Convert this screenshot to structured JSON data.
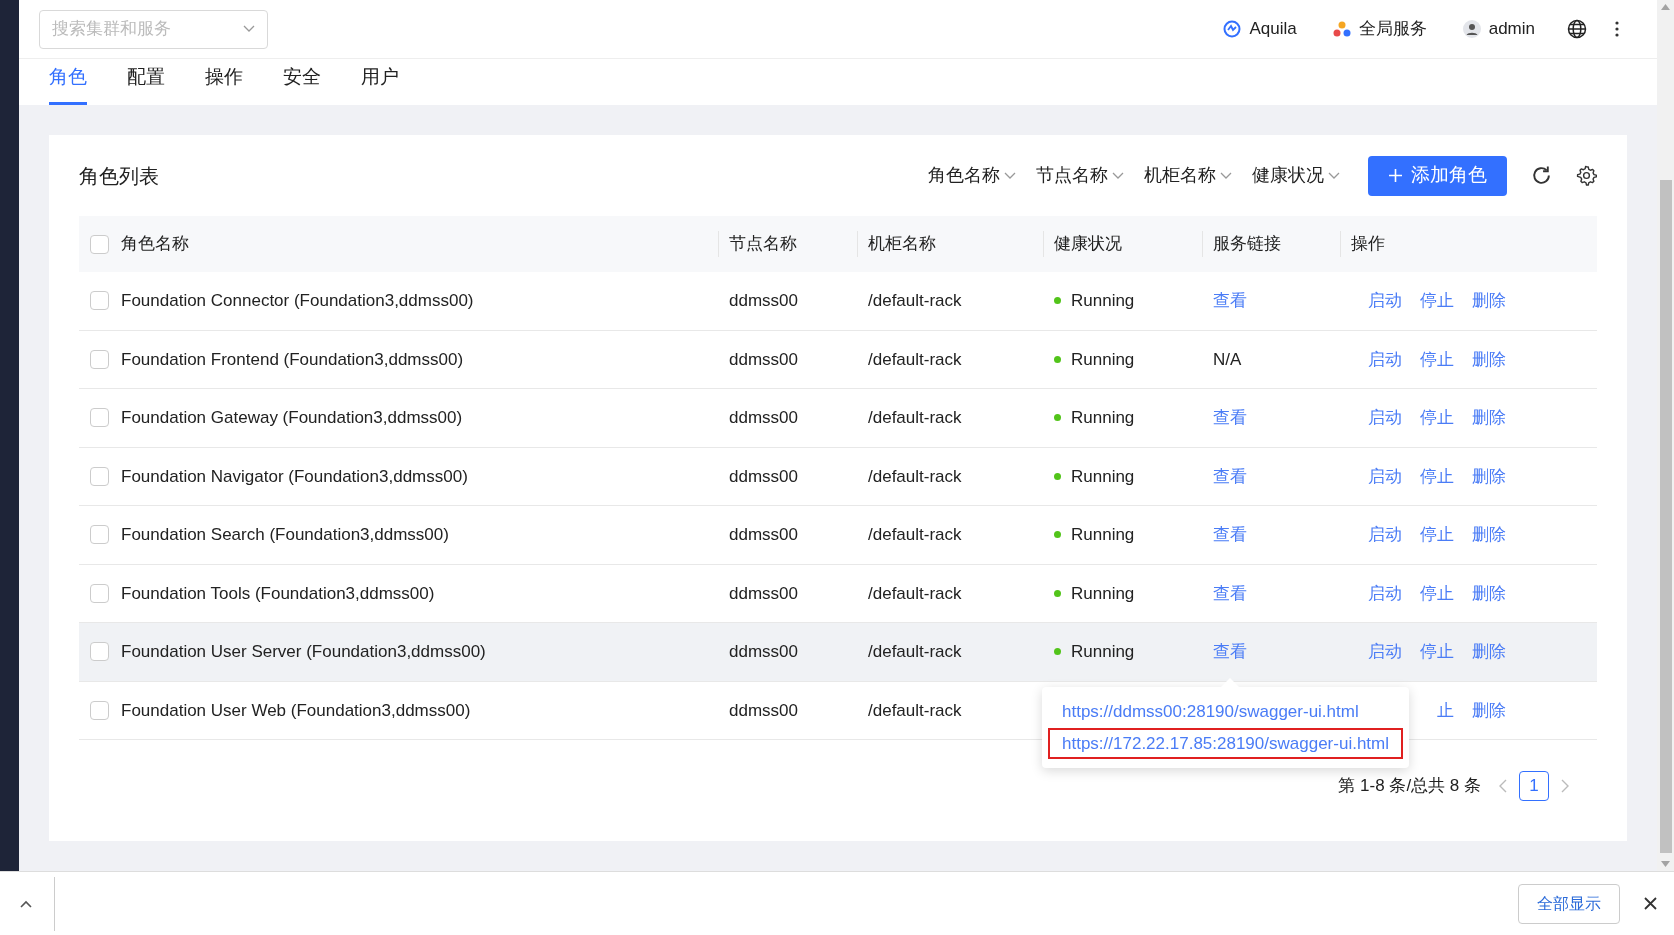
{
  "header": {
    "search": {
      "placeholder": "搜索集群和服务"
    },
    "cluster": "Aquila",
    "services": "全局服务",
    "user": "admin"
  },
  "tabs": [
    {
      "label": "角色",
      "selected": true
    },
    {
      "label": "配置",
      "selected": false
    },
    {
      "label": "操作",
      "selected": false
    },
    {
      "label": "安全",
      "selected": false
    },
    {
      "label": "用户",
      "selected": false
    }
  ],
  "card": {
    "title": "角色列表",
    "filters": [
      "角色名称",
      "节点名称",
      "机柜名称",
      "健康状况"
    ],
    "add_button": "添加角色"
  },
  "table": {
    "select_all": {
      "checked": false
    },
    "columns": [
      "角色名称",
      "节点名称",
      "机柜名称",
      "健康状况",
      "服务链接",
      "操作"
    ],
    "rows": [
      {
        "checked": false,
        "hovered": false,
        "name": "Foundation Connector (Foundation3,ddmss00)",
        "node": "ddmss00",
        "rack": "/default-rack",
        "health": "Running",
        "color": "#52c41a",
        "link": "查看",
        "linked": true,
        "actions": [
          "启动",
          "停止",
          "删除"
        ]
      },
      {
        "checked": false,
        "hovered": false,
        "name": "Foundation Frontend (Foundation3,ddmss00)",
        "node": "ddmss00",
        "rack": "/default-rack",
        "health": "Running",
        "color": "#52c41a",
        "link": "N/A",
        "linked": false,
        "actions": [
          "启动",
          "停止",
          "删除"
        ]
      },
      {
        "checked": false,
        "hovered": false,
        "name": "Foundation Gateway (Foundation3,ddmss00)",
        "node": "ddmss00",
        "rack": "/default-rack",
        "health": "Running",
        "color": "#52c41a",
        "link": "查看",
        "linked": true,
        "actions": [
          "启动",
          "停止",
          "删除"
        ]
      },
      {
        "checked": false,
        "hovered": false,
        "name": "Foundation Navigator (Foundation3,ddmss00)",
        "node": "ddmss00",
        "rack": "/default-rack",
        "health": "Running",
        "color": "#52c41a",
        "link": "查看",
        "linked": true,
        "actions": [
          "启动",
          "停止",
          "删除"
        ]
      },
      {
        "checked": false,
        "hovered": false,
        "name": "Foundation Search (Foundation3,ddmss00)",
        "node": "ddmss00",
        "rack": "/default-rack",
        "health": "Running",
        "color": "#52c41a",
        "link": "查看",
        "linked": true,
        "actions": [
          "启动",
          "停止",
          "删除"
        ]
      },
      {
        "checked": false,
        "hovered": false,
        "name": "Foundation Tools (Foundation3,ddmss00)",
        "node": "ddmss00",
        "rack": "/default-rack",
        "health": "Running",
        "color": "#52c41a",
        "link": "查看",
        "linked": true,
        "actions": [
          "启动",
          "停止",
          "删除"
        ]
      },
      {
        "checked": false,
        "hovered": true,
        "name": "Foundation User Server (Foundation3,ddmss00)",
        "node": "ddmss00",
        "rack": "/default-rack",
        "health": "Running",
        "color": "#52c41a",
        "link": "查看",
        "linked": true,
        "actions": [
          "启动",
          "停止",
          "删除"
        ]
      },
      {
        "checked": false,
        "hovered": false,
        "name": "Foundation User Web (Foundation3,ddmss00)",
        "node": "ddmss00",
        "rack": "/default-rack",
        "actions": [
          "止",
          "删除"
        ]
      }
    ]
  },
  "popover": {
    "links": [
      {
        "url": "https://ddmss00:28190/swagger-ui.html",
        "selected": false
      },
      {
        "url": "https://172.22.17.85:28190/swagger-ui.html",
        "selected": true
      }
    ]
  },
  "pagination": {
    "summary": "第 1-8 条/总共 8 条",
    "pages": [
      {
        "label": "1",
        "selected": true
      }
    ]
  },
  "download_bar": {
    "show_all": "全部显示"
  }
}
